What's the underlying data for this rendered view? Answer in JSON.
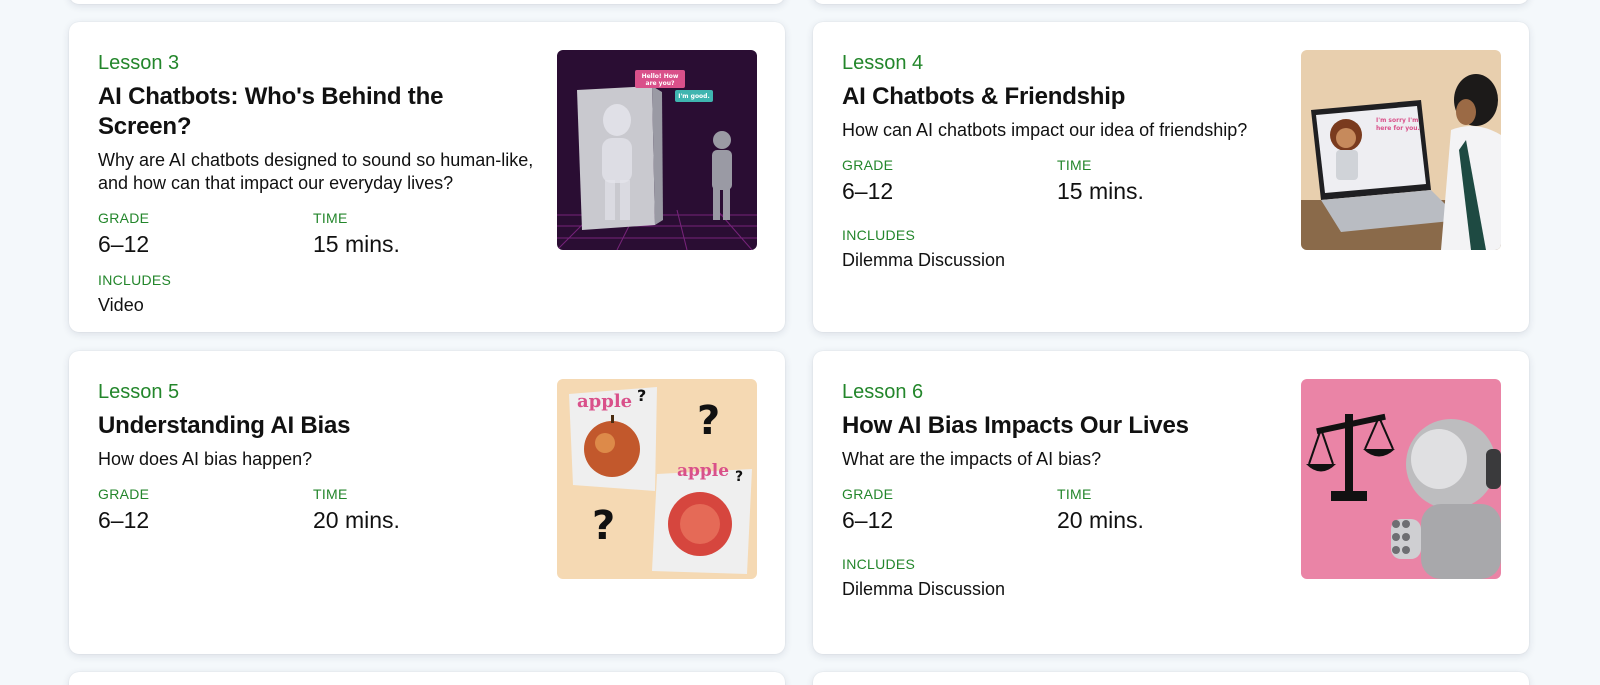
{
  "lessons": [
    {
      "label": "Lesson 3",
      "title": "AI Chatbots: Who's Behind the Screen?",
      "description": "Why are AI chatbots designed to sound so human-like, and how can that impact our everyday lives?",
      "grade_label": "GRADE",
      "grade": "6–12",
      "time_label": "TIME",
      "time": "15 mins.",
      "includes_label": "INCLUDES",
      "includes": "Video",
      "image_icon": "chatbot-hologram-image",
      "bubble1": "Hello! How are you?",
      "bubble2": "I'm good."
    },
    {
      "label": "Lesson 4",
      "title": "AI Chatbots & Friendship",
      "description": "How can AI chatbots impact our idea of friendship?",
      "grade_label": "GRADE",
      "grade": "6–12",
      "time_label": "TIME",
      "time": "15 mins.",
      "includes_label": "INCLUDES",
      "includes": "Dilemma Discussion",
      "image_icon": "laptop-chatbot-image",
      "screen_text": "I'm sorry I'm here for you."
    },
    {
      "label": "Lesson 5",
      "title": "Understanding AI Bias",
      "description": "How does AI bias happen?",
      "grade_label": "GRADE",
      "grade": "6–12",
      "time_label": "TIME",
      "time": "20 mins.",
      "image_icon": "apple-question-image",
      "apple_word": "apple"
    },
    {
      "label": "Lesson 6",
      "title": "How AI Bias Impacts Our Lives",
      "description": "What are the impacts of AI bias?",
      "grade_label": "GRADE",
      "grade": "6–12",
      "time_label": "TIME",
      "time": "20 mins.",
      "includes_label": "INCLUDES",
      "includes": "Dilemma Discussion",
      "image_icon": "robot-scales-image"
    }
  ],
  "colors": {
    "accent_green": "#23862b",
    "background": "#f4f8fb",
    "lesson3_bg": "#2a0d33",
    "lesson5_bg": "#f5d9b3",
    "lesson6_bg": "#ea84a6"
  }
}
